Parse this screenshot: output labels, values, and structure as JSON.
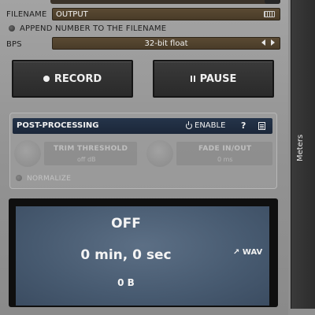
{
  "recorder": {
    "filename_label": "FILENAME",
    "filename_value": "OUTPUT",
    "append_label": "APPEND NUMBER TO THE FILENAME",
    "bps_label": "BPS",
    "bps_value": "32-bit float",
    "record_label": "RECORD",
    "pause_label": "PAUSE"
  },
  "post_processing": {
    "title": "POST-PROCESSING",
    "enable_label": "ENABLE",
    "help_label": "?",
    "trim_label": "TRIM THRESHOLD",
    "trim_value": "off dB",
    "fade_label": "FADE IN/OUT",
    "fade_value": "0 ms",
    "normalize_label": "NORMALIZE"
  },
  "display": {
    "status": "OFF",
    "time": "0 min, 0 sec",
    "size": "0 B",
    "format": "WAV"
  },
  "side": {
    "meters_label": "Meters"
  },
  "colors": {
    "panel": "#999999",
    "field_brown": "#52432e",
    "header_navy": "#22314a",
    "display_blue": "#4d6178"
  }
}
